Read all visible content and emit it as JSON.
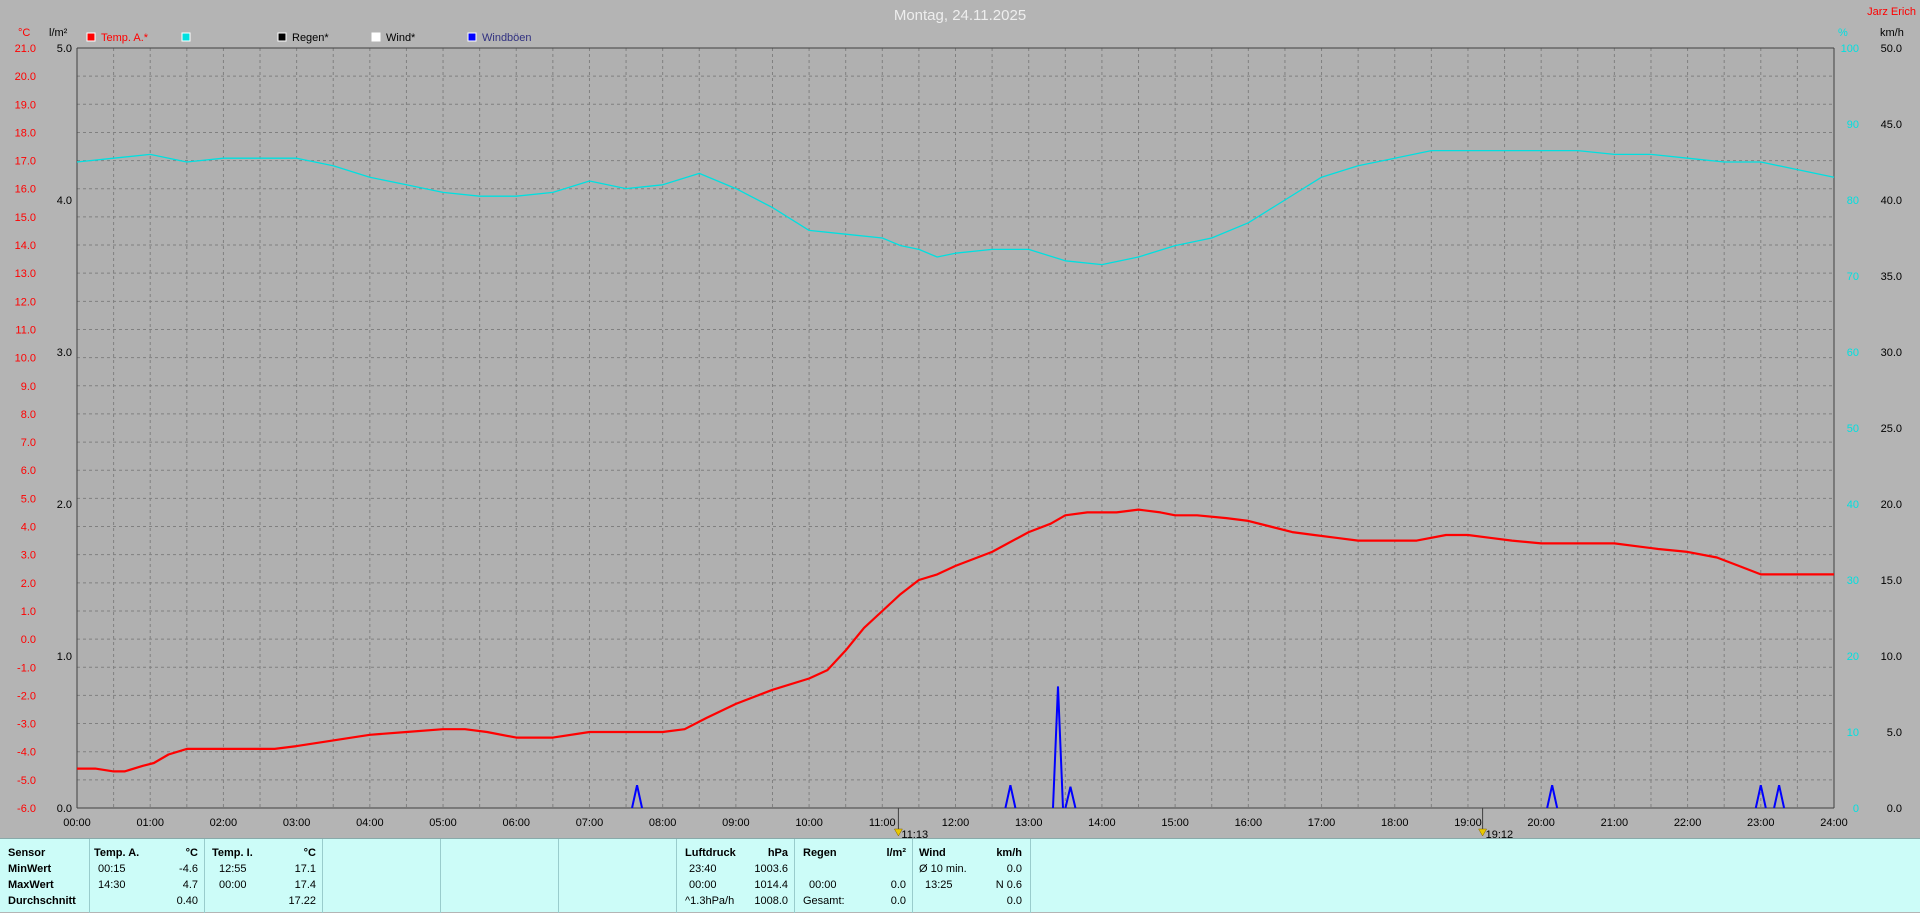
{
  "header": {
    "title": "Montag, 24.11.2025",
    "station": "Jarz Erich"
  },
  "colors": {
    "background": "#b4b4b4",
    "temp": "#ff0000",
    "humidity": "#00e0e0",
    "rain": "#000000",
    "wind": "#ffffff",
    "gust": "#0000ff",
    "panel": "#ccfcf8"
  },
  "legend": [
    {
      "label": "Temp. A.*",
      "color": "#ff0000"
    },
    {
      "label": "",
      "color": "#00e0e0"
    },
    {
      "label": "Regen*",
      "color": "#000000"
    },
    {
      "label": "Wind*",
      "color": "#ffffff"
    },
    {
      "label": "Windböen",
      "color": "#0000ff"
    }
  ],
  "chart_data": {
    "type": "line",
    "title": "Montag, 24.11.2025",
    "x_ticks": [
      "00:00",
      "01:00",
      "02:00",
      "03:00",
      "04:00",
      "05:00",
      "06:00",
      "07:00",
      "08:00",
      "09:00",
      "10:00",
      "11:00",
      "12:00",
      "13:00",
      "14:00",
      "15:00",
      "16:00",
      "17:00",
      "18:00",
      "19:00",
      "20:00",
      "21:00",
      "22:00",
      "23:00",
      "24:00"
    ],
    "axes": {
      "temp": {
        "unit": "°C",
        "min": -6,
        "max": 21,
        "ticks": [
          "21.0",
          "20.0",
          "19.0",
          "18.0",
          "17.0",
          "16.0",
          "15.0",
          "14.0",
          "13.0",
          "12.0",
          "11.0",
          "10.0",
          "9.0",
          "8.0",
          "7.0",
          "6.0",
          "5.0",
          "4.0",
          "3.0",
          "2.0",
          "1.0",
          "0.0",
          "-1.0",
          "-2.0",
          "-3.0",
          "-4.0",
          "-5.0",
          "-6.0"
        ]
      },
      "rain": {
        "unit": "l/m²",
        "min": 0,
        "max": 5,
        "ticks": [
          "5.0",
          "4.0",
          "3.0",
          "2.0",
          "1.0",
          "0.0"
        ]
      },
      "humidity": {
        "unit": "%",
        "min": 0,
        "max": 100,
        "ticks": [
          "100",
          "90",
          "80",
          "70",
          "60",
          "50",
          "40",
          "30",
          "20",
          "10",
          "0"
        ]
      },
      "wind": {
        "unit": "km/h",
        "min": 0,
        "max": 50,
        "ticks": [
          "50.0",
          "45.0",
          "40.0",
          "35.0",
          "30.0",
          "25.0",
          "20.0",
          "15.0",
          "10.0",
          "5.0",
          "0.0"
        ]
      }
    },
    "markers": [
      {
        "time": "11:13",
        "hour": 11.22
      },
      {
        "time": "19:12",
        "hour": 19.2
      }
    ],
    "series": [
      {
        "name": "Temp. A.*",
        "axis": "temp",
        "color": "#ff0000",
        "x": [
          0,
          0.25,
          0.5,
          0.65,
          0.9,
          1.05,
          1.25,
          1.5,
          2,
          2.5,
          2.7,
          3,
          3.5,
          4,
          4.5,
          5,
          5.3,
          5.6,
          6,
          6.5,
          7,
          7.5,
          8,
          8.3,
          8.6,
          9,
          9.5,
          10,
          10.25,
          10.5,
          10.75,
          11,
          11.25,
          11.5,
          11.75,
          12,
          12.5,
          13,
          13.3,
          13.5,
          13.8,
          14.2,
          14.5,
          14.8,
          15,
          15.3,
          15.7,
          16,
          16.3,
          16.6,
          16.9,
          17.2,
          17.5,
          17.9,
          18.3,
          18.7,
          19,
          19.3,
          19.6,
          20,
          20.3,
          20.6,
          21,
          21.3,
          21.6,
          22,
          22.4,
          22.7,
          23,
          23.4,
          23.7,
          24
        ],
        "y": [
          -4.6,
          -4.6,
          -4.7,
          -4.7,
          -4.5,
          -4.4,
          -4.1,
          -3.9,
          -3.9,
          -3.9,
          -3.9,
          -3.8,
          -3.6,
          -3.4,
          -3.3,
          -3.2,
          -3.2,
          -3.3,
          -3.5,
          -3.5,
          -3.3,
          -3.3,
          -3.3,
          -3.2,
          -2.8,
          -2.3,
          -1.8,
          -1.4,
          -1.1,
          -0.4,
          0.4,
          1.0,
          1.6,
          2.1,
          2.3,
          2.6,
          3.1,
          3.8,
          4.1,
          4.4,
          4.5,
          4.5,
          4.6,
          4.5,
          4.4,
          4.4,
          4.3,
          4.2,
          4.0,
          3.8,
          3.7,
          3.6,
          3.5,
          3.5,
          3.5,
          3.7,
          3.7,
          3.6,
          3.5,
          3.4,
          3.4,
          3.4,
          3.4,
          3.3,
          3.2,
          3.1,
          2.9,
          2.6,
          2.3,
          2.3,
          2.3,
          2.3
        ]
      },
      {
        "name": "",
        "axis": "humidity",
        "color": "#00e0e0",
        "x": [
          0,
          0.5,
          1,
          1.5,
          2,
          2.5,
          3,
          3.5,
          4,
          4.5,
          5,
          5.5,
          6,
          6.5,
          7,
          7.5,
          8,
          8.5,
          9,
          9.5,
          10,
          10.5,
          11,
          11.25,
          11.5,
          11.75,
          12,
          12.5,
          13,
          13.5,
          14,
          14.5,
          15,
          15.5,
          16,
          16.5,
          17,
          17.5,
          18,
          18.5,
          19,
          19.5,
          20,
          20.5,
          21,
          21.5,
          22,
          22.5,
          23,
          23.5,
          24
        ],
        "y": [
          85,
          85.5,
          86,
          85,
          85.5,
          85.5,
          85.5,
          84.5,
          83,
          82,
          81,
          80.5,
          80.5,
          81,
          82.5,
          81.5,
          82,
          83.5,
          81.5,
          79,
          76,
          75.5,
          75,
          74,
          73.5,
          72.5,
          73,
          73.5,
          73.5,
          72,
          71.5,
          72.5,
          74,
          75,
          77,
          80,
          83,
          84.5,
          85.5,
          86.5,
          86.5,
          86.5,
          86.5,
          86.5,
          86,
          86,
          85.5,
          85,
          85,
          84,
          83
        ]
      },
      {
        "name": "Windböen",
        "axis": "wind",
        "color": "#0000ff",
        "type": "spike",
        "x": [
          7.65,
          12.75,
          13.4,
          13.57,
          20.15,
          23.0,
          23.25
        ],
        "y": [
          1.5,
          1.5,
          8.0,
          1.4,
          1.5,
          1.5,
          1.5
        ]
      }
    ]
  },
  "panel": {
    "sensor": {
      "header": "Sensor",
      "rows": [
        "MinWert",
        "MaxWert",
        "Durchschnitt"
      ]
    },
    "temp_a": {
      "header": "Temp. A.",
      "unit": "°C",
      "min_time": "00:15",
      "min_val": "-4.6",
      "max_time": "14:30",
      "max_val": "4.7",
      "avg": "0.40"
    },
    "temp_i": {
      "header": "Temp. I.",
      "unit": "°C",
      "min_time": "12:55",
      "min_val": "17.1",
      "max_time": "00:00",
      "max_val": "17.4",
      "avg": "17.22"
    },
    "pressure": {
      "header": "Luftdruck",
      "unit": "hPa",
      "min_time": "23:40",
      "min_val": "1003.6",
      "max_time": "00:00",
      "max_val": "1014.4",
      "trend_label": "^1.3hPa/h",
      "avg": "1008.0"
    },
    "rain": {
      "header": "Regen",
      "unit": "l/m²",
      "max_time": "00:00",
      "max_val": "0.0",
      "total_label": "Gesamt:",
      "total": "0.0"
    },
    "wind": {
      "header": "Wind",
      "unit": "km/h",
      "min_label": "Ø 10 min.",
      "min_val": "0.0",
      "max_time": "13:25",
      "max_val": "N 0.6",
      "avg": "0.0"
    }
  }
}
